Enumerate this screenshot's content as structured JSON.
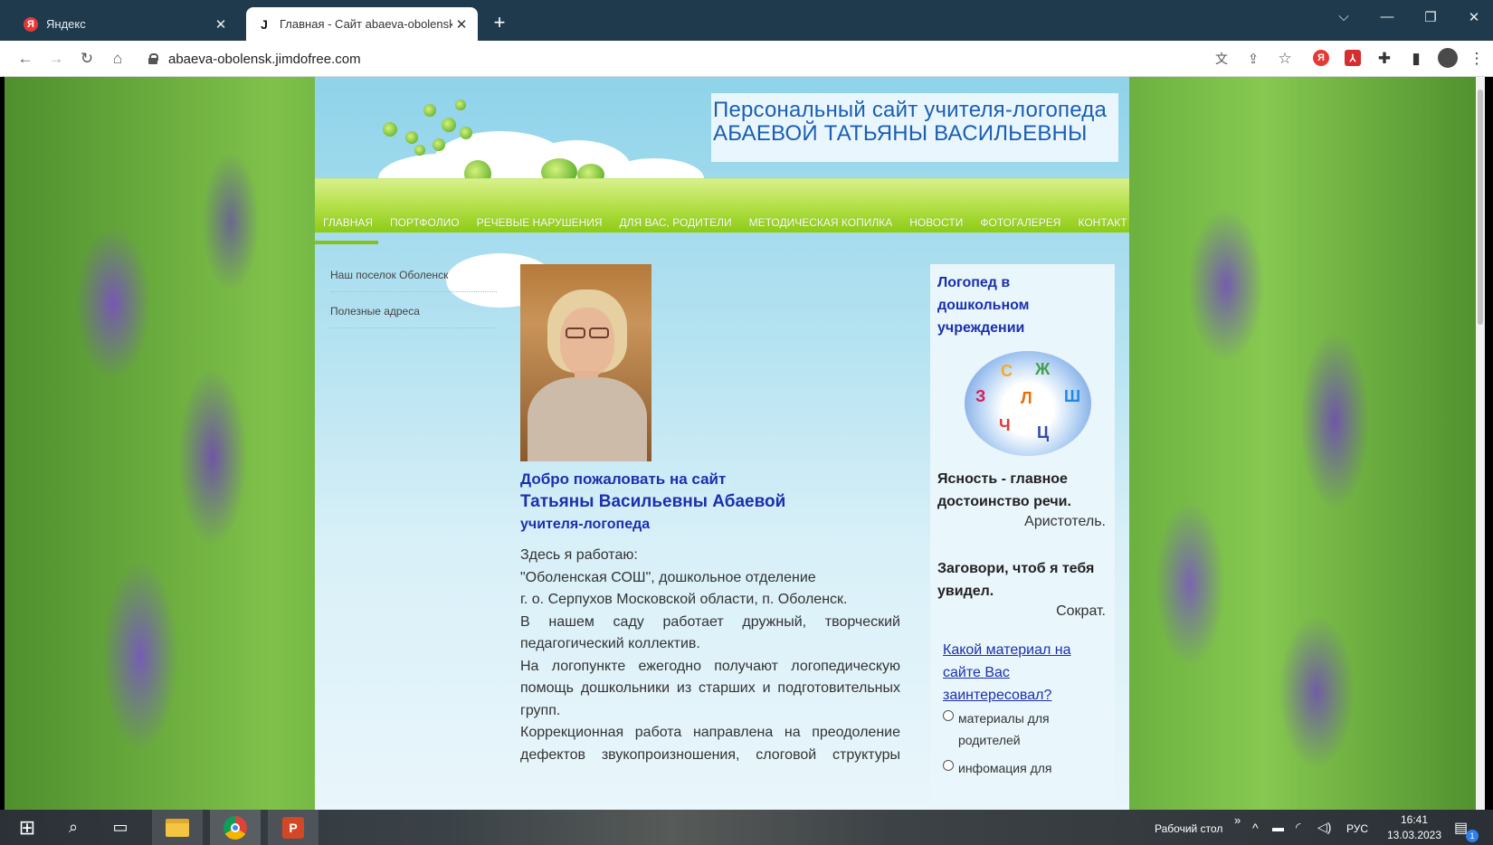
{
  "browser": {
    "tabs": [
      {
        "label": "Яндекс",
        "favicon": "Я",
        "active": false
      },
      {
        "label": "Главная - Сайт abaeva-obolensk",
        "favicon": "J",
        "active": true
      }
    ],
    "new_tab": "+",
    "url": "abaeva-obolensk.jimdofree.com"
  },
  "site": {
    "banner_line1": "Персональный сайт учителя-логопеда",
    "banner_line2": "АБАЕВОЙ ТАТЬЯНЫ  ВАСИЛЬЕВНЫ",
    "nav": [
      "ГЛАВНАЯ",
      "ПОРТФОЛИО",
      "РЕЧЕВЫЕ НАРУШЕНИЯ",
      "ДЛЯ ВАС, РОДИТЕЛИ",
      "МЕТОДИЧЕСКАЯ КОПИЛКА",
      "НОВОСТИ",
      "ФОТОГАЛЕРЕЯ",
      "КОНТАКТ"
    ],
    "subnav": [
      "Наш поселок Оболенск",
      "Полезные адреса"
    ],
    "welcome": {
      "line1": "Добро пожаловать на сайт",
      "line2": "Татьяны Васильевны Абаевой",
      "line3": "учителя-логопеда"
    },
    "body": {
      "p1": "Здесь я работаю:",
      "p2": "\"Оболенская СОШ\", дошкольное отделение",
      "p3": "г. о. Серпухов Московской области, п. Оболенск.",
      "p4a": "В нашем саду работает дружный, творческий",
      "p4b": "педагогический коллектив.",
      "p5a": "На логопункте ежегодно получают логопедическую",
      "p5b": "помощь дошкольники из старших и подготовительных",
      "p5c": "групп.",
      "p6a": "Коррекционная работа направлена на преодоление",
      "p6b": "дефектов звукопроизношения, слоговой структуры"
    },
    "sidebar": {
      "title": "Логопед в дошкольном учреждении",
      "quote1": "Ясность - главное достоинство речи.",
      "quote1_author": "Аристотель.",
      "quote2": "Заговори, чтоб я тебя увидел.",
      "quote2_author": "Сократ.",
      "poll_question": "Какой материал на сайте Вас заинтересовал?",
      "poll_option1": "материалы для родителей",
      "poll_option2": "инфомация для"
    }
  },
  "taskbar": {
    "desktop_label": "Рабочий стол",
    "language": "РУС",
    "time": "16:41",
    "date": "13.03.2023",
    "notifications": "1"
  },
  "colors": {
    "tabstrip": "#1f3a4c",
    "nav_green": "#8dcb16",
    "title_blue": "#1b2fb0",
    "banner_blue": "#1b5fb3"
  }
}
